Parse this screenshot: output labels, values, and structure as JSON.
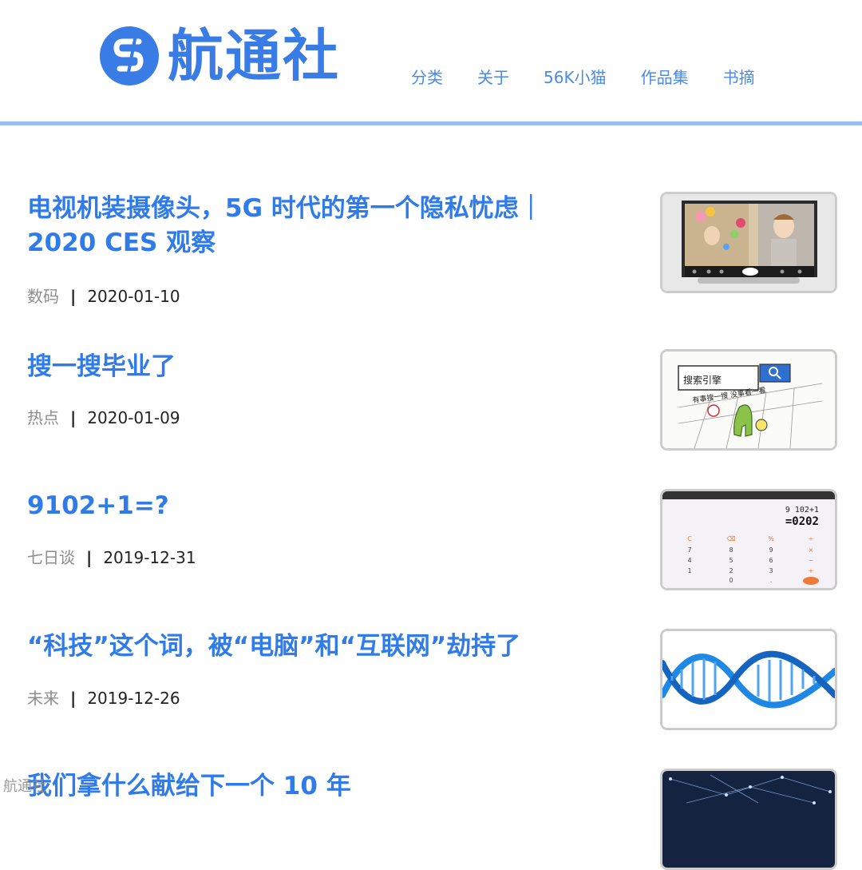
{
  "header": {
    "logo_text": "航通社",
    "nav": [
      "分类",
      "关于",
      "56K小猫",
      "作品集",
      "书摘"
    ]
  },
  "colors": {
    "accent": "#2f7be9",
    "nav": "#4a8be8",
    "divider": "#9bbcf5",
    "meta_category": "#8d8d8d",
    "meta_date": "#222222"
  },
  "articles": [
    {
      "title": "电视机装摄像头，5G 时代的第一个隐私忧虑｜2020 CES 观察",
      "category": "数码",
      "separator": "|",
      "date": "2020-01-10",
      "thumb_icon": "tv-camera-image"
    },
    {
      "title": "搜一搜毕业了",
      "category": "热点",
      "separator": "|",
      "date": "2020-01-09",
      "thumb_icon": "search-cartoon-image",
      "thumb_text": {
        "box": "搜索引擎",
        "line": "有事搜一搜 没事看一看"
      }
    },
    {
      "title": "9102+1=?",
      "category": "七日谈",
      "separator": "|",
      "date": "2019-12-31",
      "thumb_icon": "calculator-image",
      "thumb_text": {
        "expr": "9 102+1",
        "result": "=0202"
      }
    },
    {
      "title": "“科技”这个词，被“电脑”和“互联网”劫持了",
      "category": "未来",
      "separator": "|",
      "date": "2019-12-26",
      "thumb_icon": "dna-helix-image"
    },
    {
      "title": "我们拿什么献给下一个 10 年",
      "thumb_icon": "network-image"
    }
  ],
  "watermark": "航通社"
}
